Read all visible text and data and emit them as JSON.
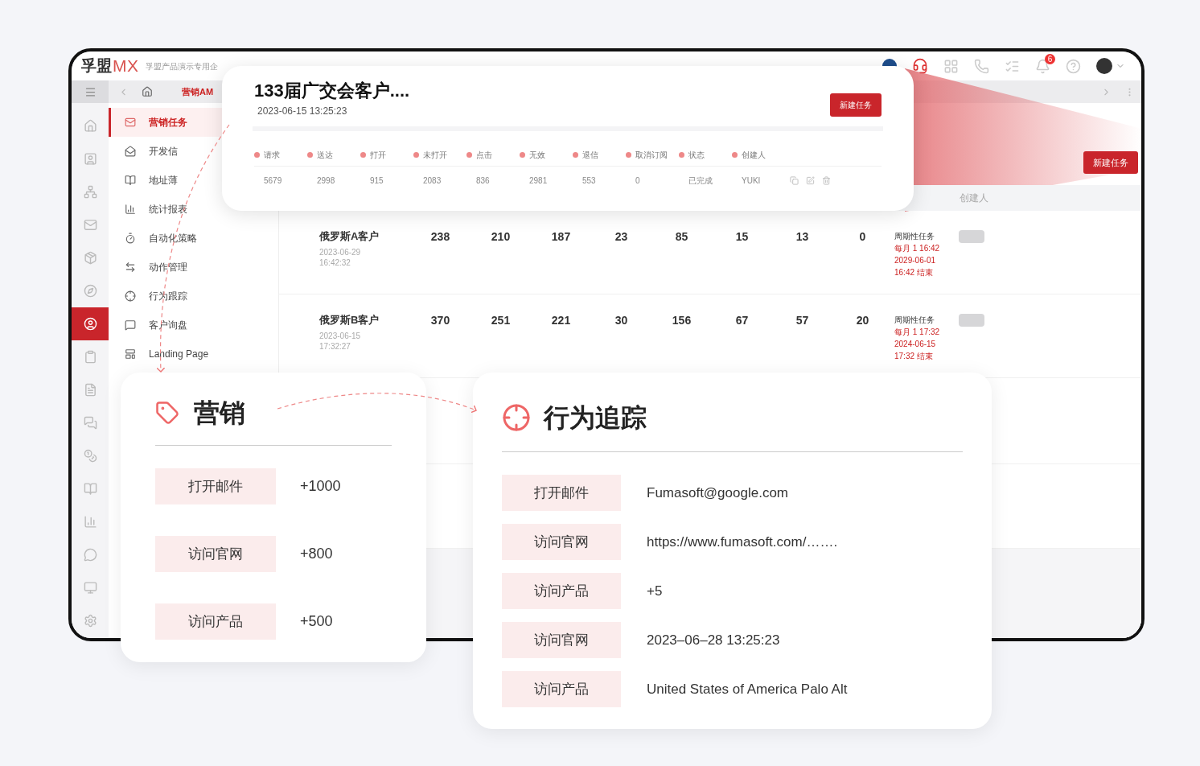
{
  "header": {
    "logo_cn": "孚盟",
    "logo_en": "MX",
    "company": "孚盟产品演示专用企",
    "notification_count": "6"
  },
  "tab_bar": {
    "tab": "营销AM"
  },
  "rail": [
    {
      "kind": "home",
      "selected": false
    },
    {
      "kind": "user",
      "selected": false
    },
    {
      "kind": "network",
      "selected": false
    },
    {
      "kind": "mail",
      "selected": false
    },
    {
      "kind": "box",
      "selected": false
    },
    {
      "kind": "compass",
      "selected": false
    },
    {
      "kind": "user-circle",
      "selected": true
    },
    {
      "kind": "clipboard",
      "selected": false
    },
    {
      "kind": "document",
      "selected": false
    },
    {
      "kind": "chat",
      "selected": false
    },
    {
      "kind": "coins",
      "selected": false
    },
    {
      "kind": "book",
      "selected": false
    },
    {
      "kind": "chart",
      "selected": false
    },
    {
      "kind": "chat-bubble",
      "selected": false
    },
    {
      "kind": "monitor",
      "selected": false
    },
    {
      "kind": "settings",
      "selected": false
    }
  ],
  "menu": [
    {
      "label": "营销任务",
      "kind": "mail",
      "selected": true
    },
    {
      "label": "开发信",
      "kind": "mail-open",
      "selected": false
    },
    {
      "label": "地址薄",
      "kind": "book",
      "selected": false
    },
    {
      "label": "统计报表",
      "kind": "chart",
      "selected": false
    },
    {
      "label": "自动化策略",
      "kind": "timer",
      "selected": false
    },
    {
      "label": "动作管理",
      "kind": "switch",
      "selected": false
    },
    {
      "label": "行为跟踪",
      "kind": "target",
      "selected": false
    },
    {
      "label": "客户询盘",
      "kind": "message",
      "selected": false
    },
    {
      "label": "Landing Page",
      "kind": "layout",
      "selected": false
    }
  ],
  "main": {
    "new_task_button": "新建任务",
    "column_header": "创建人",
    "rows": [
      {
        "name": "俄罗斯A客户",
        "date": "2023-06-29",
        "time": "16:42:32",
        "values": [
          "238",
          "210",
          "187",
          "23",
          "85",
          "15",
          "13",
          "0"
        ],
        "schedule_type": "周期性任务",
        "schedule": [
          "每月 1 16:42",
          "2029-06-01",
          "16:42 结束"
        ],
        "on": false
      },
      {
        "name": "俄罗斯B客户",
        "date": "2023-06-15",
        "time": "17:32:27",
        "values": [
          "370",
          "251",
          "221",
          "30",
          "156",
          "67",
          "57",
          "20"
        ],
        "schedule_type": "周期性任务",
        "schedule": [
          "每月 1 17:32",
          "2024-06-15",
          "17:32 结束"
        ],
        "on": false
      }
    ]
  },
  "popup": {
    "title": "133届广交会客户....",
    "datetime": "2023-06-15 13:25:23",
    "button": "新建任务",
    "columns": [
      "请求",
      "送达",
      "打开",
      "未打开",
      "点击",
      "无效",
      "退信",
      "取消订阅",
      "状态",
      "创建人"
    ],
    "values": [
      "5679",
      "2998",
      "915",
      "2083",
      "836",
      "2981",
      "553",
      "0",
      "已完成",
      "YUKI"
    ]
  },
  "marketing_card": {
    "title": "营销",
    "items": [
      {
        "action": "打开邮件",
        "points": "+1000"
      },
      {
        "action": "访问官网",
        "points": "+800"
      },
      {
        "action": "访问产品",
        "points": "+500"
      }
    ]
  },
  "tracking_card": {
    "title": "行为追踪",
    "items": [
      {
        "action": "打开邮件",
        "value": "Fumasoft@google.com"
      },
      {
        "action": "访问官网",
        "value": "https://www.fumasoft.com/……."
      },
      {
        "action": "访问产品",
        "value": "+5"
      },
      {
        "action": "访问官网",
        "value": "2023–06–28 13:25:23"
      },
      {
        "action": "访问产品",
        "value": "United States of America Palo Alt"
      }
    ]
  }
}
